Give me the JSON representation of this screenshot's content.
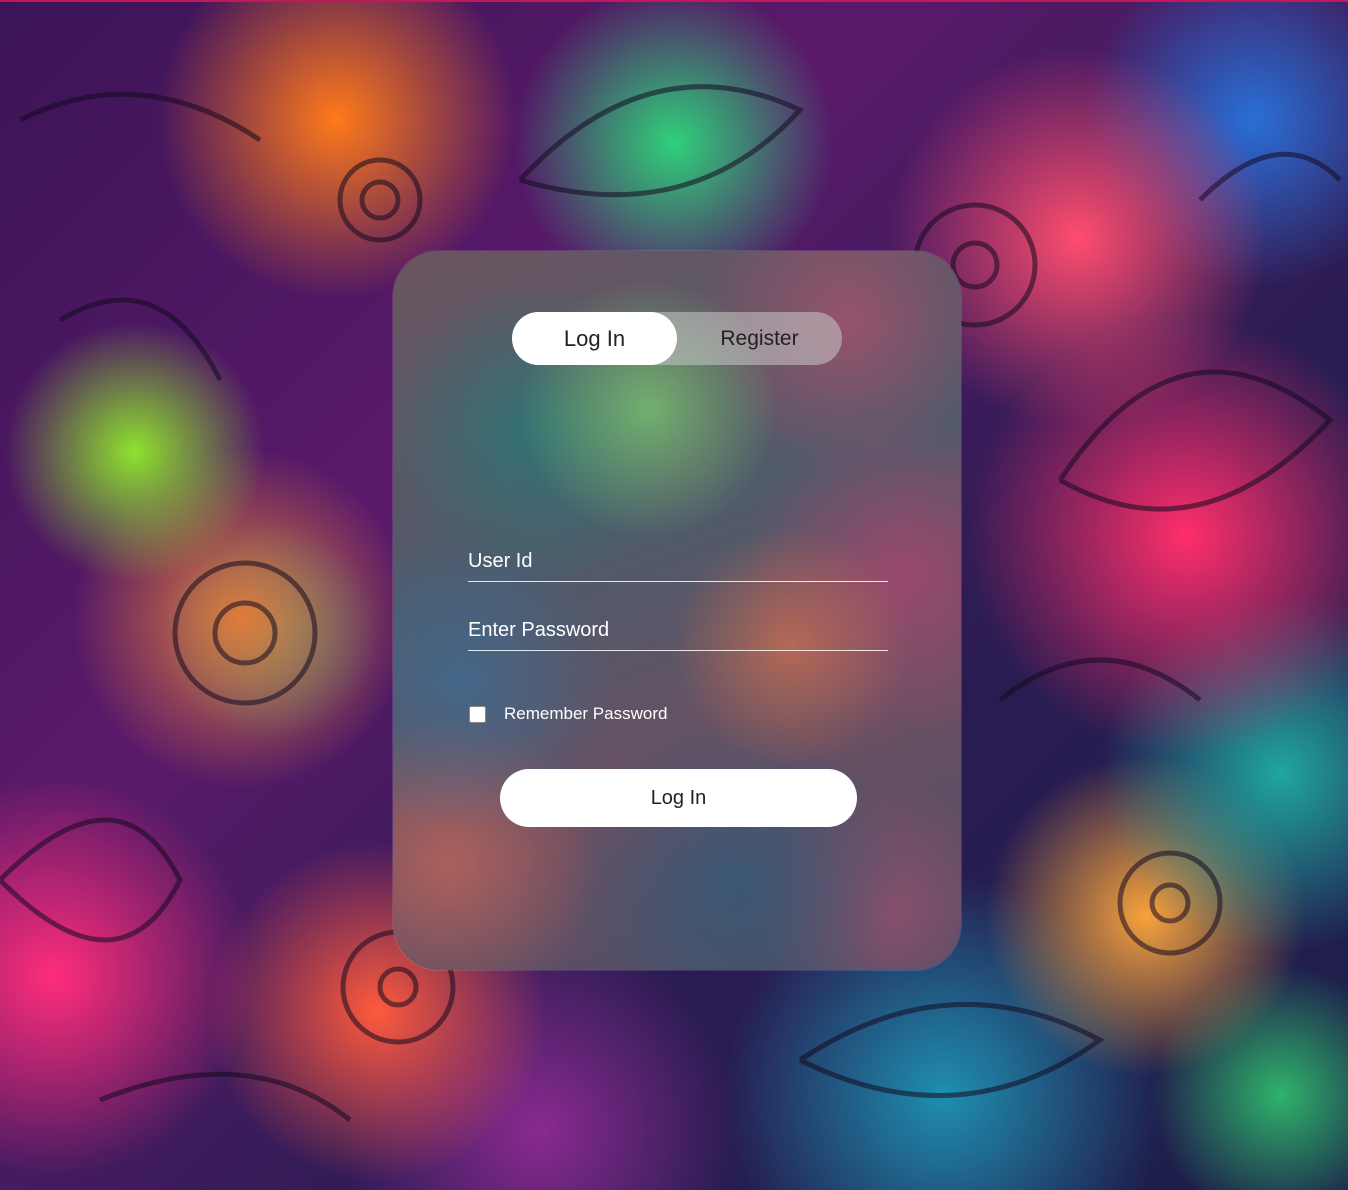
{
  "tabs": {
    "login_label": "Log In",
    "register_label": "Register"
  },
  "form": {
    "user_placeholder": "User Id",
    "password_placeholder": "Enter Password",
    "remember_label": "Remember Password",
    "remember_checked": false,
    "submit_label": "Log In"
  },
  "colors": {
    "active_tab": "#ffffff",
    "button_bg": "#ffffff",
    "text_light": "#ffffff",
    "text_dark": "#222222"
  },
  "background": {
    "icon": "floral-pattern-background"
  }
}
